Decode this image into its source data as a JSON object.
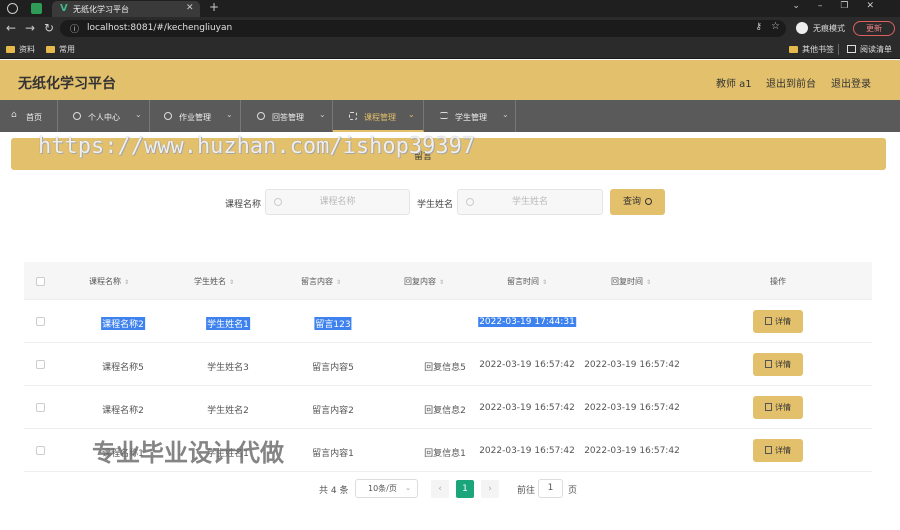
{
  "browser": {
    "tab_title": "无纸化学习平台",
    "tab_logo": "V",
    "url": "localhost:8081/#/kechengliuyan",
    "profile_label": "无痕模式",
    "update_label": "更新",
    "bookmarks": [
      "资料",
      "常用",
      "其他书签",
      "阅读清单"
    ]
  },
  "header": {
    "title": "无纸化学习平台",
    "user": "教师 a1",
    "back_front": "退出到前台",
    "logout": "退出登录"
  },
  "nav": {
    "items": [
      "首页",
      "个人中心",
      "作业管理",
      "回答管理",
      "课程管理",
      "学生管理"
    ],
    "active": "课程管理"
  },
  "breadcrumb": "留言",
  "watermarks": {
    "url": "https://www.huzhan.com/ishop39397",
    "slogan": "专业毕业设计代做"
  },
  "search": {
    "course_label": "课程名称",
    "course_placeholder": "课程名称",
    "student_label": "学生姓名",
    "student_placeholder": "学生姓名",
    "query_label": "查询"
  },
  "table": {
    "columns": [
      "课程名称",
      "学生姓名",
      "留言内容",
      "回复内容",
      "留言时间",
      "回复时间",
      "操作"
    ],
    "rows": [
      {
        "course": "课程名称2",
        "student": "学生姓名1",
        "message": "留言123",
        "reply": "",
        "msg_time": "2022-03-19 17:44:31",
        "reply_time": "",
        "selected": true
      },
      {
        "course": "课程名称5",
        "student": "学生姓名3",
        "message": "留言内容5",
        "reply": "回复信息5",
        "msg_time": "2022-03-19 16:57:42",
        "reply_time": "2022-03-19 16:57:42",
        "selected": false
      },
      {
        "course": "课程名称2",
        "student": "学生姓名2",
        "message": "留言内容2",
        "reply": "回复信息2",
        "msg_time": "2022-03-19 16:57:42",
        "reply_time": "2022-03-19 16:57:42",
        "selected": false
      },
      {
        "course": "课程名称1",
        "student": "学生姓名1",
        "message": "留言内容1",
        "reply": "回复信息1",
        "msg_time": "2022-03-19 16:57:42",
        "reply_time": "2022-03-19 16:57:42",
        "selected": false
      }
    ],
    "detail_label": "详情"
  },
  "pagination": {
    "total": "共 4 条",
    "page_size": "10条/页",
    "current_page": "1",
    "goto_label": "前往",
    "goto_value": "1",
    "goto_unit": "页"
  },
  "colors": {
    "accent": "#e3c06b",
    "nav_bg": "#5a5a5a",
    "page_active": "#1aa57a",
    "selection": "#3d82ee"
  }
}
